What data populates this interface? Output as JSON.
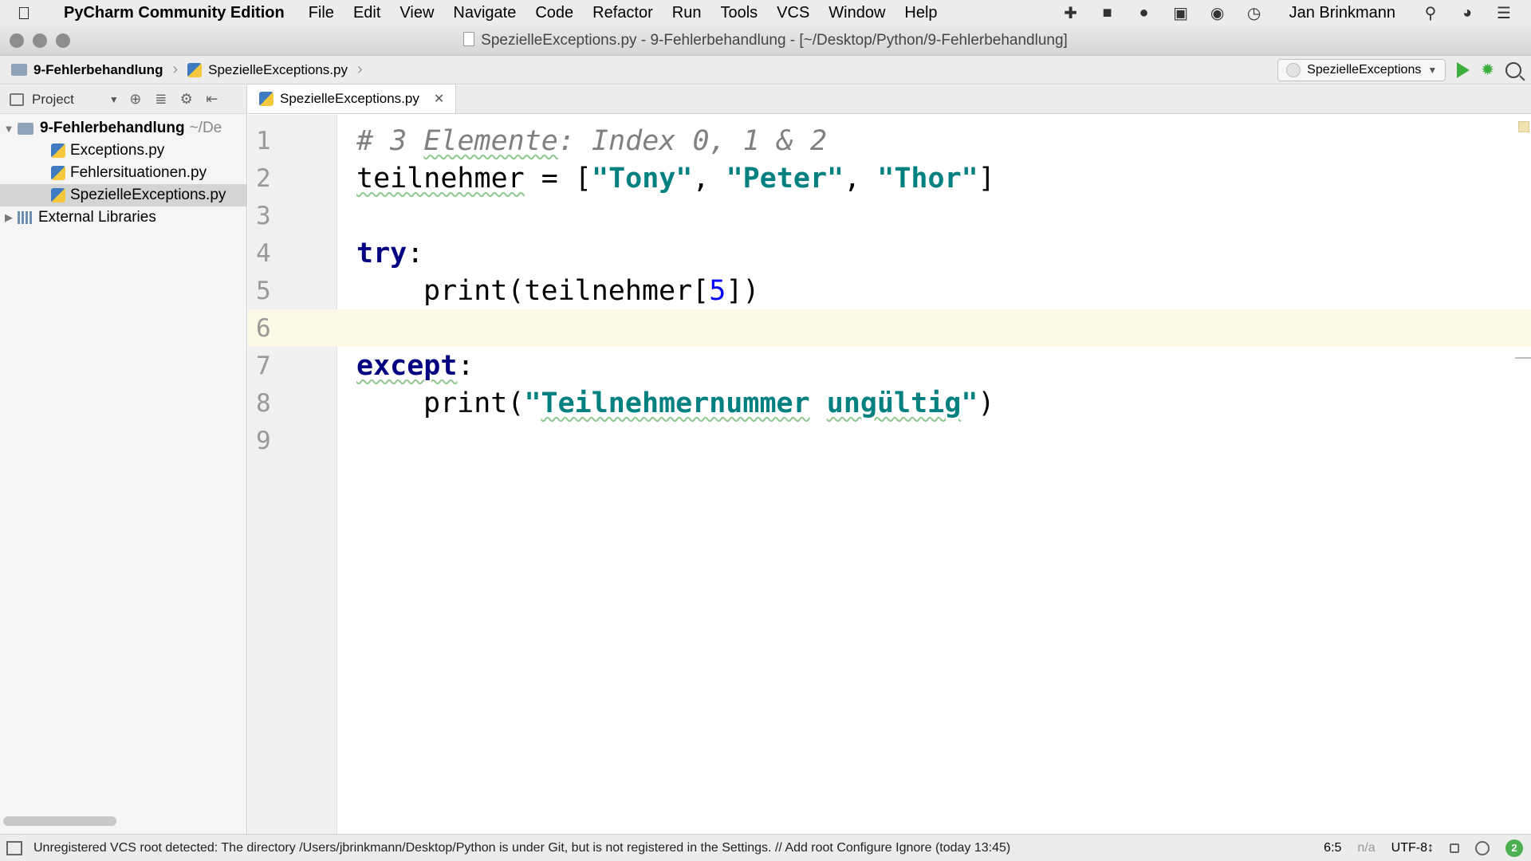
{
  "menubar": {
    "app_name": "PyCharm Community Edition",
    "items": [
      "File",
      "Edit",
      "View",
      "Navigate",
      "Code",
      "Refactor",
      "Run",
      "Tools",
      "VCS",
      "Window",
      "Help"
    ],
    "user": "Jan Brinkmann"
  },
  "window": {
    "title": "SpezielleExceptions.py - 9-Fehlerbehandlung - [~/Desktop/Python/9-Fehlerbehandlung]"
  },
  "breadcrumb": {
    "folder": "9-Fehlerbehandlung",
    "file": "SpezielleExceptions.py"
  },
  "run_config": {
    "name": "SpezielleExceptions"
  },
  "project_panel": {
    "label": "Project",
    "root_name": "9-Fehlerbehandlung",
    "root_path": "~/De",
    "files": [
      "Exceptions.py",
      "Fehlersituationen.py",
      "SpezielleExceptions.py"
    ],
    "external": "External Libraries"
  },
  "editor": {
    "tab_label": "SpezielleExceptions.py",
    "line_numbers": [
      "1",
      "2",
      "3",
      "4",
      "5",
      "6",
      "7",
      "8",
      "9"
    ],
    "tokens": {
      "l1_comment_a": "# 3 ",
      "l1_comment_b": "Elemente",
      "l1_comment_c": ": Index 0, 1 & 2",
      "l2_var": "teilnehmer",
      "l2_op": " = [",
      "l2_s1": "\"Tony\"",
      "l2_c1": ", ",
      "l2_s2": "\"Peter\"",
      "l2_c2": ", ",
      "l2_s3": "\"Thor\"",
      "l2_end": "]",
      "l4_kw": "try",
      "l4_colon": ":",
      "l5_a": "print(teilnehmer[",
      "l5_num": "5",
      "l5_b": "])",
      "l7_kw": "except",
      "l7_colon": ":",
      "l8_a": "print(",
      "l8_q": "\"",
      "l8_w1": "Teilnehmernummer",
      "l8_sp": " ",
      "l8_w2": "ungültig",
      "l8_q2": "\"",
      "l8_b": ")"
    }
  },
  "statusbar": {
    "message": "Unregistered VCS root detected: The directory /Users/jbrinkmann/Desktop/Python is under Git, but is not registered in the Settings. // Add root  Configure  Ignore (today 13:45)",
    "position": "6:5",
    "na": "n/a",
    "encoding": "UTF-8↕",
    "badge": "2"
  }
}
